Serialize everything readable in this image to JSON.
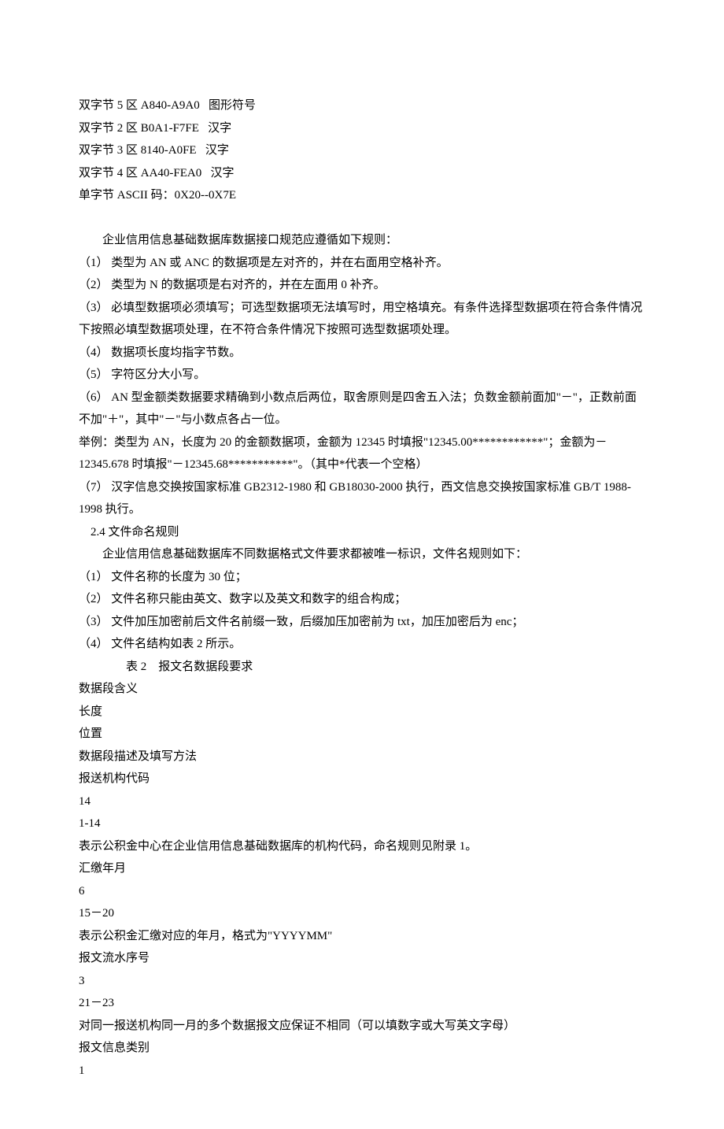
{
  "lines": {
    "byte5": "双字节 5 区 A840-A9A0   图形符号",
    "byte2": "双字节 2 区 B0A1-F7FE   汉字",
    "byte3": "双字节 3 区 8140-A0FE   汉字",
    "byte4": "双字节 4 区 AA40-FEA0   汉字",
    "ascii": "单字节 ASCII 码：0X20--0X7E",
    "blank1": " ",
    "intro": "企业信用信息基础数据库数据接口规范应遵循如下规则：",
    "rule1": "（1） 类型为 AN 或 ANC 的数据项是左对齐的，并在右面用空格补齐。",
    "rule2": "（2） 类型为 N 的数据项是右对齐的，并在左面用 0 补齐。",
    "rule3": "（3） 必填型数据项必须填写；可选型数据项无法填写时，用空格填充。有条件选择型数据项在符合条件情况下按照必填型数据项处理，在不符合条件情况下按照可选型数据项处理。",
    "rule4": "（4） 数据项长度均指字节数。",
    "rule5": "（5） 字符区分大小写。",
    "rule6": "（6） AN 型金额类数据要求精确到小数点后两位，取舍原则是四舍五入法；负数金额前面加\"－\"，正数前面不加\"＋\"，其中\"－\"与小数点各占一位。",
    "example": "举例：类型为 AN，长度为 20 的金额数据项，金额为 12345 时填报\"12345.00************\"；金额为－12345.678 时填报\"－12345.68***********\"。（其中*代表一个空格）",
    "rule7": "（7） 汉字信息交换按国家标准 GB2312-1980 和 GB18030-2000 执行，西文信息交换按国家标准 GB/T 1988-1998 执行。",
    "section24": "2.4 文件命名规则",
    "fileintro": "企业信用信息基础数据库不同数据格式文件要求都被唯一标识，文件名规则如下：",
    "frule1": "（1） 文件名称的长度为 30 位；",
    "frule2": "（2） 文件名称只能由英文、数字以及英文和数字的组合构成；",
    "frule3": "（3） 文件加压加密前后文件名前缀一致，后缀加压加密前为 txt，加压加密后为 enc；",
    "frule4": "（4） 文件名结构如表 2 所示。",
    "table2caption": "表 2　报文名数据段要求",
    "th1": "数据段含义",
    "th2": "长度",
    "th3": "位置",
    "th4": "数据段描述及填写方法",
    "r1c1": "报送机构代码",
    "r1c2": "14",
    "r1c3": "1-14",
    "r1c4": "表示公积金中心在企业信用信息基础数据库的机构代码，命名规则见附录 1。",
    "r2c1": "汇缴年月",
    "r2c2": "6",
    "r2c3": "15－20",
    "r2c4": "表示公积金汇缴对应的年月，格式为\"YYYYMM\"",
    "r3c1": "报文流水序号",
    "r3c2": "3",
    "r3c3": "21－23",
    "r3c4": "对同一报送机构同一月的多个数据报文应保证不相同（可以填数字或大写英文字母）",
    "r4c1": "报文信息类别",
    "r4c2": "1"
  }
}
